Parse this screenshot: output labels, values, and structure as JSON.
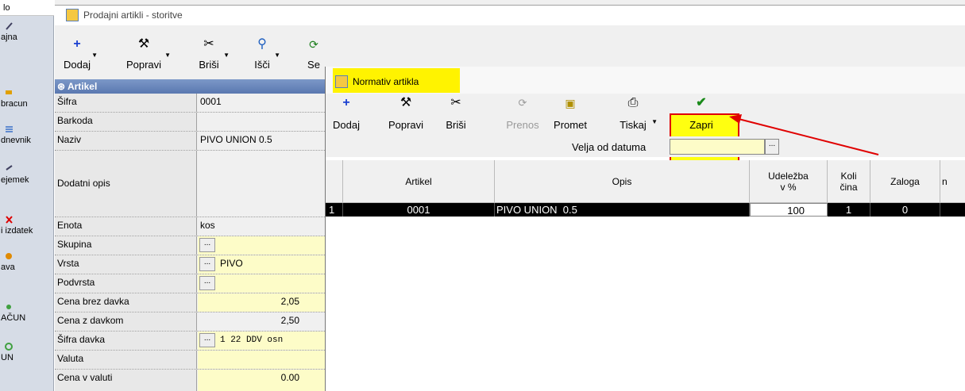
{
  "left_nav": {
    "top_label": "lo",
    "items": [
      {
        "label": "ajna",
        "icon": "pen-icon"
      },
      {
        "label": "bracun",
        "icon": "pencil-icon"
      },
      {
        "label": "dnevnik",
        "icon": "list-icon"
      },
      {
        "label": "ejemek",
        "icon": "check-icon"
      },
      {
        "label": "i izdatek",
        "icon": "x-icon"
      },
      {
        "label": "ava",
        "icon": "gear-icon"
      },
      {
        "label": "AČUN",
        "icon": "circle-icon"
      },
      {
        "label": "UN",
        "icon": "circle-icon"
      }
    ]
  },
  "main_window": {
    "title": "Prodajni artikli - storitve",
    "toolbar": [
      {
        "label": "Dodaj",
        "icon": "plus-icon"
      },
      {
        "label": "Popravi",
        "icon": "hammer-icon"
      },
      {
        "label": "Briši",
        "icon": "scissors-icon"
      },
      {
        "label": "Išči",
        "icon": "search-icon"
      },
      {
        "label": "Se",
        "icon": "refresh-icon"
      }
    ],
    "panel_header": "Artikel",
    "fields": [
      {
        "label": "Šifra",
        "value": "0001"
      },
      {
        "label": "Barkoda",
        "value": ""
      },
      {
        "label": "Naziv",
        "value": "PIVO UNION  0.5"
      },
      {
        "label": "Dodatni opis",
        "value": ""
      },
      {
        "label": "Enota",
        "value": "kos"
      },
      {
        "label": "Skupina",
        "value": ""
      },
      {
        "label": "Vrsta",
        "value": "PIVO"
      },
      {
        "label": "Podvrsta",
        "value": ""
      },
      {
        "label": "Cena brez davka",
        "value": "2,05"
      },
      {
        "label": "Cena z davkom",
        "value": "2,50"
      },
      {
        "label": "Šifra davka",
        "value": "1      22 DDV osn"
      },
      {
        "label": "Valuta",
        "value": ""
      },
      {
        "label": "Cena v valuti",
        "value": "0.00"
      }
    ]
  },
  "dialog": {
    "title": "Normativ artikla",
    "toolbar": [
      {
        "label": "Dodaj",
        "icon": "plus-icon",
        "enabled": true
      },
      {
        "label": "Popravi",
        "icon": "hammer-icon",
        "enabled": true
      },
      {
        "label": "Briši",
        "icon": "scissors-icon",
        "enabled": true
      },
      {
        "label": "Prenos",
        "icon": "transfer-icon",
        "enabled": false
      },
      {
        "label": "Promet",
        "icon": "traffic-icon",
        "enabled": true
      },
      {
        "label": "Tiskaj",
        "icon": "printer-icon",
        "enabled": true
      },
      {
        "label": "Zapri",
        "icon": "checkmark-icon",
        "enabled": true
      }
    ],
    "date_label": "Velja od datuma",
    "date_value": "",
    "grid_headers": [
      "Artikel",
      "Opis",
      "Udeležba v %",
      "Koli čina",
      "Zaloga",
      "n"
    ],
    "rows": [
      {
        "num": "1",
        "artikel": "0001",
        "opis": "PIVO UNION  0.5",
        "udelezba": "100",
        "kolicina": "1",
        "zaloga": "0"
      }
    ]
  },
  "colors": {
    "highlight": "#fff300",
    "annotation": "#e00000",
    "field_yellow": "#fdfcc8"
  }
}
